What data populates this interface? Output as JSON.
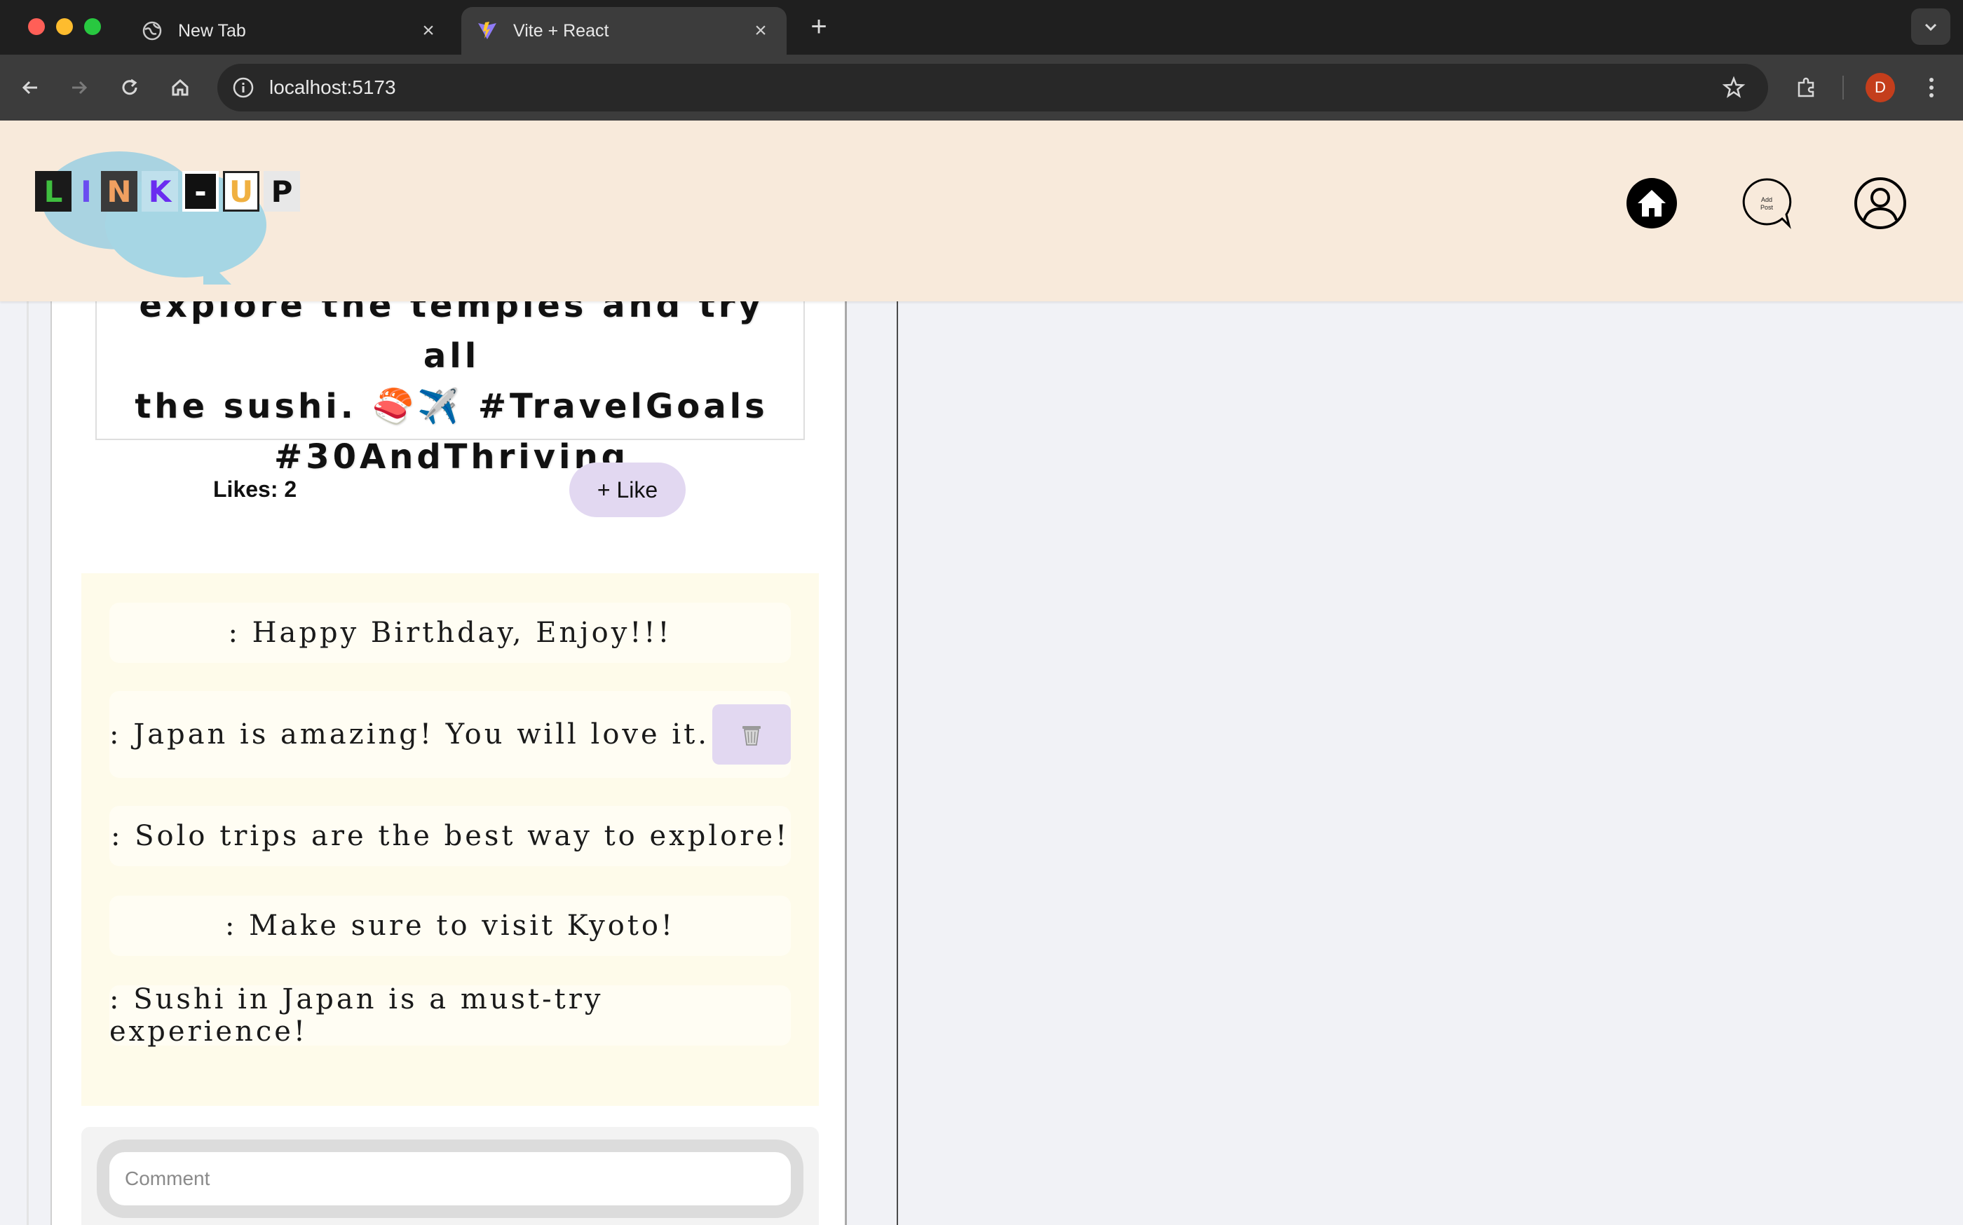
{
  "browser": {
    "tabs": [
      {
        "label": "New Tab",
        "active": false
      },
      {
        "label": "Vite + React",
        "active": true
      }
    ],
    "url": "localhost:5173",
    "profile_initial": "D"
  },
  "header": {
    "logo_text": "LINK-UP",
    "nav": [
      {
        "name": "home",
        "icon": "home-icon"
      },
      {
        "name": "add-post",
        "icon": "speech-bubble-icon",
        "label_line1": "Add",
        "label_line2": "Post"
      },
      {
        "name": "profile",
        "icon": "user-icon"
      }
    ]
  },
  "post": {
    "text_partial_line": "explore the temples and try all",
    "text_line2": "the sushi. 🍣✈️ #TravelGoals",
    "text_line3": "#30AndThriving",
    "likes_label": "Likes: 2",
    "like_button": "+ Like"
  },
  "comments": [
    {
      "text": ": Happy Birthday, Enjoy!!!",
      "deletable": false
    },
    {
      "text": ": Japan is amazing! You will love it.",
      "deletable": true
    },
    {
      "text": ": Solo trips are the best way to explore!",
      "deletable": false
    },
    {
      "text": ": Make sure to visit Kyoto!",
      "deletable": false
    },
    {
      "text": ": Sushi in Japan is a must-try experience!",
      "deletable": false
    }
  ],
  "comment_input": {
    "placeholder": "Comment",
    "value": ""
  },
  "colors": {
    "header_bg": "#f8eadb",
    "like_button_bg": "#e2d8f1",
    "comments_bg": "#fefbea",
    "page_bg": "#f1f2f6"
  }
}
